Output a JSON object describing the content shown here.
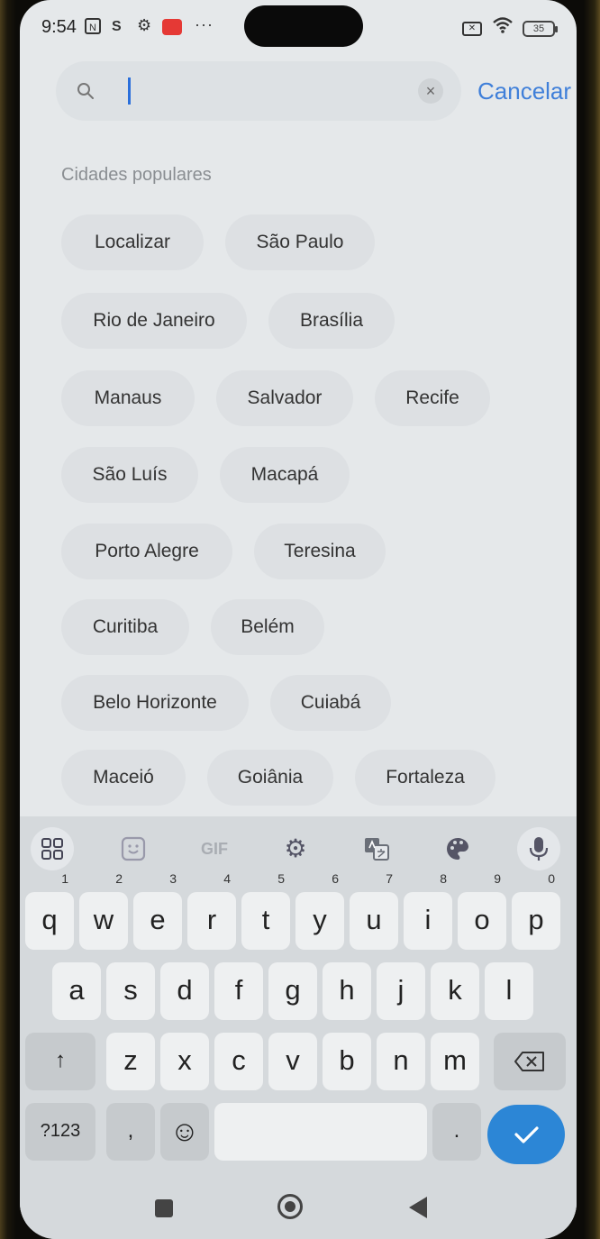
{
  "status_bar": {
    "time": "9:54",
    "nfc": "N",
    "sim": "S",
    "more": "···",
    "battery": "35"
  },
  "search": {
    "value": "",
    "cancel_label": "Cancelar"
  },
  "section_title": "Cidades populares",
  "cities": [
    "Localizar",
    "São Paulo",
    "Rio de Janeiro",
    "Brasília",
    "Manaus",
    "Salvador",
    "Recife",
    "São Luís",
    "Macapá",
    "Porto Alegre",
    "Teresina",
    "Curitiba",
    "Belém",
    "Belo Horizonte",
    "Cuiabá",
    "Maceió",
    "Goiânia",
    "Fortaleza"
  ],
  "keyboard": {
    "toolbar": {
      "gif": "GIF"
    },
    "row1": [
      {
        "k": "q",
        "n": "1"
      },
      {
        "k": "w",
        "n": "2"
      },
      {
        "k": "e",
        "n": "3"
      },
      {
        "k": "r",
        "n": "4"
      },
      {
        "k": "t",
        "n": "5"
      },
      {
        "k": "y",
        "n": "6"
      },
      {
        "k": "u",
        "n": "7"
      },
      {
        "k": "i",
        "n": "8"
      },
      {
        "k": "o",
        "n": "9"
      },
      {
        "k": "p",
        "n": "0"
      }
    ],
    "row2": [
      "a",
      "s",
      "d",
      "f",
      "g",
      "h",
      "j",
      "k",
      "l"
    ],
    "row3": [
      "z",
      "x",
      "c",
      "v",
      "b",
      "n",
      "m"
    ],
    "shift": "↑",
    "symbols": "?123",
    "comma": ",",
    "period": ".",
    "emoji": "☺"
  },
  "colors": {
    "accent": "#3f7fd9",
    "enter_key": "#2c86d6",
    "mail_icon": "#e53935"
  }
}
